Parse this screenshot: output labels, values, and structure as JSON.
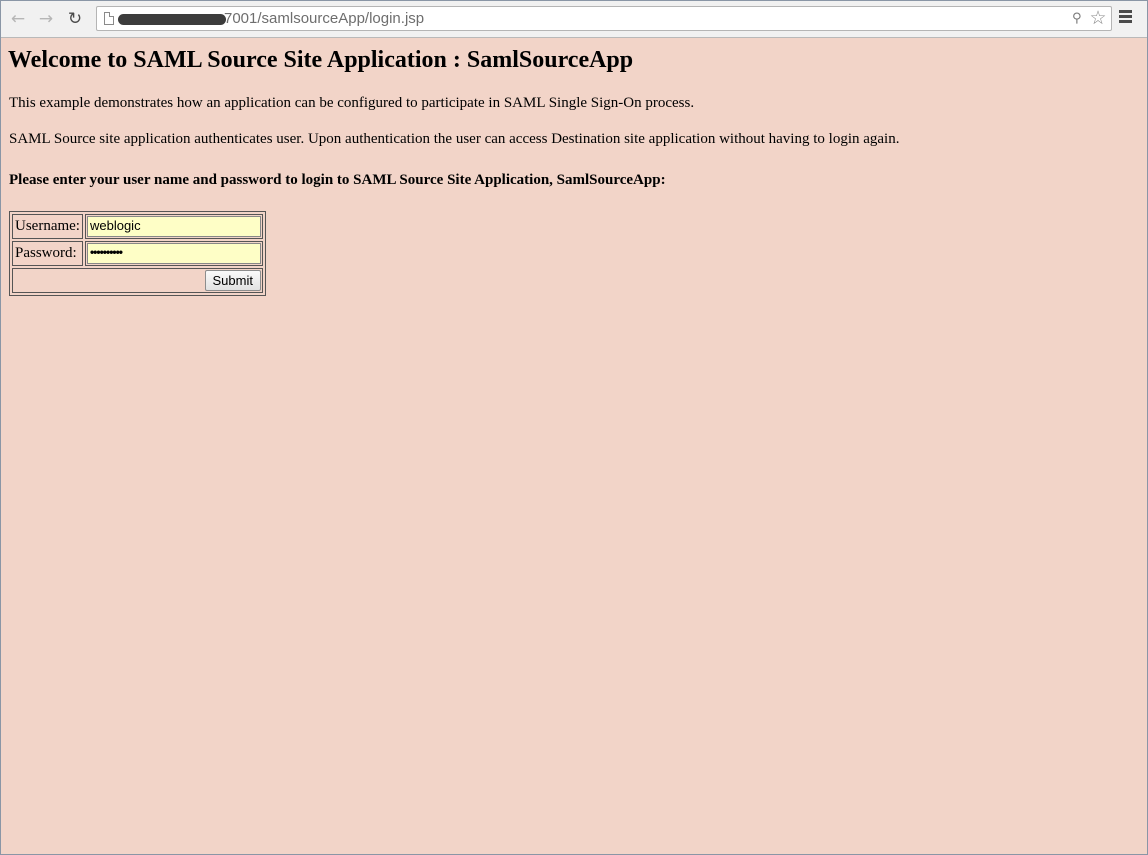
{
  "browser": {
    "url_visible": "7001/samlsourceApp/login.jsp",
    "back_icon": "back-arrow-icon",
    "forward_icon": "forward-arrow-icon",
    "reload_icon": "reload-icon",
    "page_icon": "page-icon",
    "key_icon": "key-icon",
    "star_icon": "star-icon",
    "menu_icon": "menu-icon"
  },
  "page": {
    "title": "Welcome to SAML Source Site Application : SamlSourceApp",
    "intro": "This example demonstrates how an application can be configured to participate in SAML Single Sign-On process.",
    "description": "SAML Source site application authenticates user. Upon authentication the user can access Destination site application without having to login again.",
    "prompt": "Please enter your user name and password to login to SAML Source Site Application, SamlSourceApp:",
    "background_color": "#f2d4c8"
  },
  "form": {
    "username_label": "Username:",
    "username_value": "weblogic",
    "password_label": "Password:",
    "password_masked": "••••••••••",
    "submit_label": "Submit",
    "field_color": "#fefec6"
  }
}
